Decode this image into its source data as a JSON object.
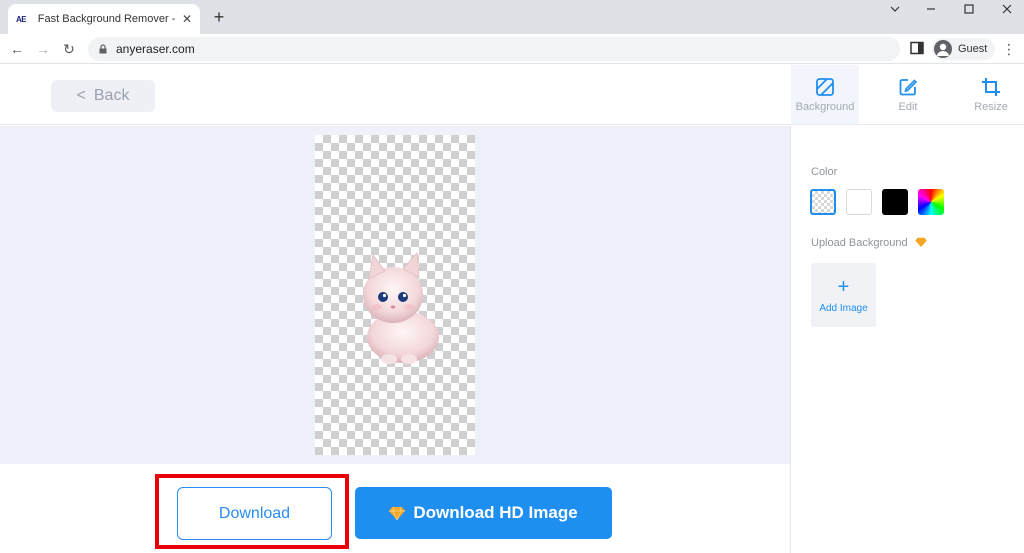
{
  "browser": {
    "tab": {
      "favicon_text": "AE",
      "title": "Fast Background Remover - Rem",
      "close": "✕"
    },
    "new_tab": "+",
    "window_controls": {
      "minimize": "—",
      "maximize": "☐",
      "close": "✕"
    },
    "nav": {
      "back": "←",
      "forward": "→",
      "reload": "↻"
    },
    "url": "anyeraser.com",
    "profile_label": "Guest",
    "menu": "⋮"
  },
  "header": {
    "back_label": "Back",
    "back_chevron": "<",
    "tools": [
      {
        "label": "Background",
        "icon": "background-icon",
        "active": true
      },
      {
        "label": "Edit",
        "icon": "edit-icon",
        "active": false
      },
      {
        "label": "Resize",
        "icon": "crop-icon",
        "active": false
      }
    ]
  },
  "actions": {
    "download_label": "Download",
    "download_hd_label": "Download HD Image"
  },
  "panel": {
    "color_label": "Color",
    "swatches": [
      {
        "name": "transparent",
        "color": "transparent",
        "selected": true
      },
      {
        "name": "white",
        "color": "#ffffff",
        "selected": false
      },
      {
        "name": "black",
        "color": "#000000",
        "selected": false
      },
      {
        "name": "rainbow",
        "color": "multicolor",
        "selected": false
      }
    ],
    "upload_label": "Upload Background",
    "add_image_plus": "+",
    "add_image_label": "Add Image"
  },
  "colors": {
    "accent": "#1f8ef1",
    "highlight": "#e8000b",
    "gem": "#f5a623"
  }
}
